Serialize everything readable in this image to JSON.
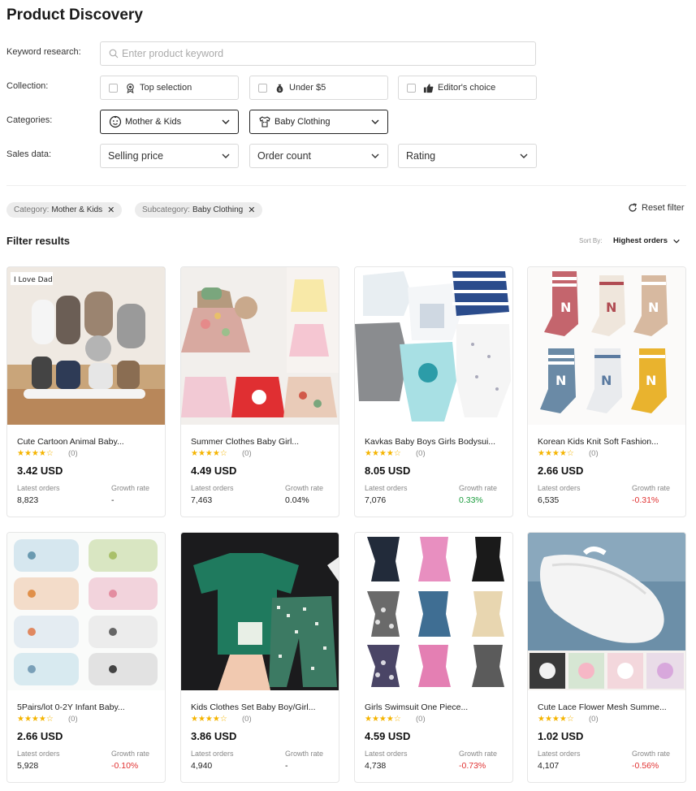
{
  "page_title": "Product Discovery",
  "keyword": {
    "label": "Keyword research:",
    "placeholder": "Enter product keyword",
    "value": ""
  },
  "collection": {
    "label": "Collection:",
    "options": [
      {
        "label": "Top selection",
        "icon": "award-icon",
        "checked": false
      },
      {
        "label": "Under $5",
        "icon": "money-bag-icon",
        "checked": false
      },
      {
        "label": "Editor's choice",
        "icon": "thumbs-up-icon",
        "checked": false
      }
    ]
  },
  "categories": {
    "label": "Categories:",
    "category": "Mother & Kids",
    "subcategory": "Baby Clothing"
  },
  "sales_data": {
    "label": "Sales data:",
    "selects": [
      "Selling price",
      "Order count",
      "Rating"
    ]
  },
  "chips": [
    {
      "key": "Category:",
      "value": "Mother & Kids"
    },
    {
      "key": "Subcategory:",
      "value": "Baby Clothing"
    }
  ],
  "reset_label": "Reset filter",
  "results_title": "Filter results",
  "sort": {
    "label": "Sort By:",
    "value": "Highest orders"
  },
  "card_labels": {
    "latest_orders": "Latest orders",
    "growth_rate": "Growth rate"
  },
  "colors": {
    "star": "#f5b400",
    "positive": "#1a9c3c",
    "negative": "#e03131"
  },
  "products": [
    {
      "name": "Cute Cartoon Animal Baby...",
      "stars": "★★★★☆",
      "rating_count": "(0)",
      "price": "3.42 USD",
      "orders": "8,823",
      "growth": "-",
      "trend": "none",
      "image": "baby-socks-photo"
    },
    {
      "name": "Summer Clothes Baby Girl...",
      "stars": "★★★★☆",
      "rating_count": "(0)",
      "price": "4.49 USD",
      "orders": "7,463",
      "growth": "0.04%",
      "trend": "pos",
      "image": "girl-dresses-photo"
    },
    {
      "name": "Kavkas Baby Boys Girls Bodysui...",
      "stars": "★★★★☆",
      "rating_count": "(0)",
      "price": "8.05 USD",
      "orders": "7,076",
      "growth": "0.33%",
      "trend": "pos",
      "image": "bodysuits-photo"
    },
    {
      "name": "Korean Kids Knit Soft Fashion...",
      "stars": "★★★★☆",
      "rating_count": "(0)",
      "price": "2.66 USD",
      "orders": "6,535",
      "growth": "-0.31%",
      "trend": "neg",
      "image": "knit-socks-photo"
    },
    {
      "name": "5Pairs/lot 0-2Y Infant Baby...",
      "stars": "★★★★☆",
      "rating_count": "(0)",
      "price": "2.66 USD",
      "orders": "5,928",
      "growth": "-0.10%",
      "trend": "neg",
      "image": "infant-socks-photo"
    },
    {
      "name": "Kids Clothes Set Baby Boy/Girl...",
      "stars": "★★★★☆",
      "rating_count": "(0)",
      "price": "3.86 USD",
      "orders": "4,940",
      "growth": "-",
      "trend": "none",
      "image": "clothes-set-photo"
    },
    {
      "name": "Girls Swimsuit One Piece...",
      "stars": "★★★★☆",
      "rating_count": "(0)",
      "price": "4.59 USD",
      "orders": "4,738",
      "growth": "-0.73%",
      "trend": "neg",
      "image": "swimsuits-photo"
    },
    {
      "name": "Cute Lace Flower Mesh Summe...",
      "stars": "★★★★☆",
      "rating_count": "(0)",
      "price": "1.02 USD",
      "orders": "4,107",
      "growth": "-0.56%",
      "trend": "neg",
      "image": "lace-socks-photo"
    }
  ]
}
